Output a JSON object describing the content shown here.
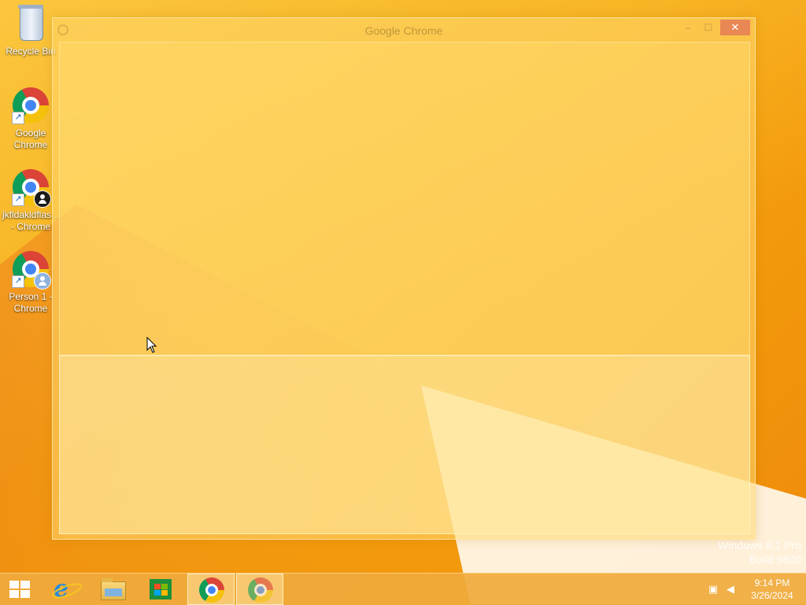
{
  "desktop": {
    "icons": [
      {
        "label": "Recycle Bin"
      },
      {
        "label": "Google Chrome"
      },
      {
        "label": "jkfldakldflas... - Chrome"
      },
      {
        "label": "Person 1 - Chrome"
      }
    ],
    "badge_colors": {
      "profile_dark": "#1a1a1a",
      "profile_blue": "#8fb4e6"
    }
  },
  "window": {
    "title": "Google Chrome",
    "controls": {
      "minimize": "–",
      "maximize": "☐",
      "close": "✕"
    }
  },
  "watermark": {
    "line1": "Windows 8.1 Pro",
    "line2": "Build 9600"
  },
  "taskbar": {
    "items": [
      {
        "name": "start",
        "icon": "windows-logo-icon"
      },
      {
        "name": "internet-explorer",
        "icon": "ie-icon"
      },
      {
        "name": "file-explorer",
        "icon": "folder-icon"
      },
      {
        "name": "store",
        "icon": "store-icon"
      },
      {
        "name": "chrome-1",
        "icon": "chrome-icon"
      },
      {
        "name": "chrome-2",
        "icon": "chrome-icon"
      }
    ],
    "tray": {
      "network_icon": "network-icon",
      "volume_icon": "volume-muted-icon",
      "time": "9:14 PM",
      "date": "3/26/2024"
    }
  },
  "colors": {
    "wallpaper": "#f5a80f",
    "close_button": "#e16e5a"
  }
}
